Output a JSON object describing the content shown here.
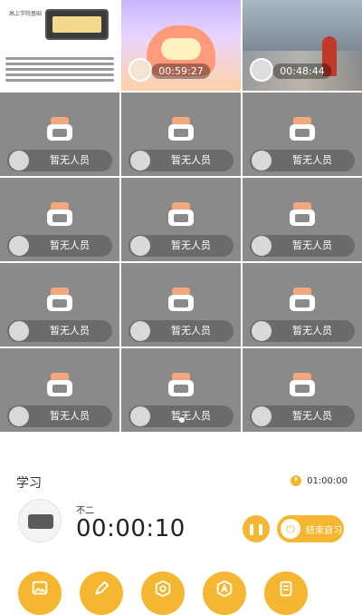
{
  "grid": {
    "videos": [
      {
        "type": "document",
        "doc_title": "高上学院基础",
        "timer": ""
      },
      {
        "type": "lion",
        "timer": "00:59:27"
      },
      {
        "type": "city",
        "timer": "00:48:44"
      }
    ],
    "empty_label": "暂无人员"
  },
  "panel": {
    "title": "学习",
    "total_time": "01:00:00",
    "task_name": "不二",
    "elapsed": "00:00:10",
    "pause_icon": "pause-icon",
    "end_label": "结束自习"
  },
  "tools": [
    {
      "icon": "picture-icon"
    },
    {
      "icon": "pencil-icon"
    },
    {
      "icon": "search-document-icon"
    },
    {
      "icon": "font-a-icon"
    },
    {
      "icon": "schedule-icon"
    }
  ],
  "colors": {
    "accent": "#f5b731",
    "seat_orange": "#f2a77e",
    "grid_gray": "#8a8a8a"
  }
}
